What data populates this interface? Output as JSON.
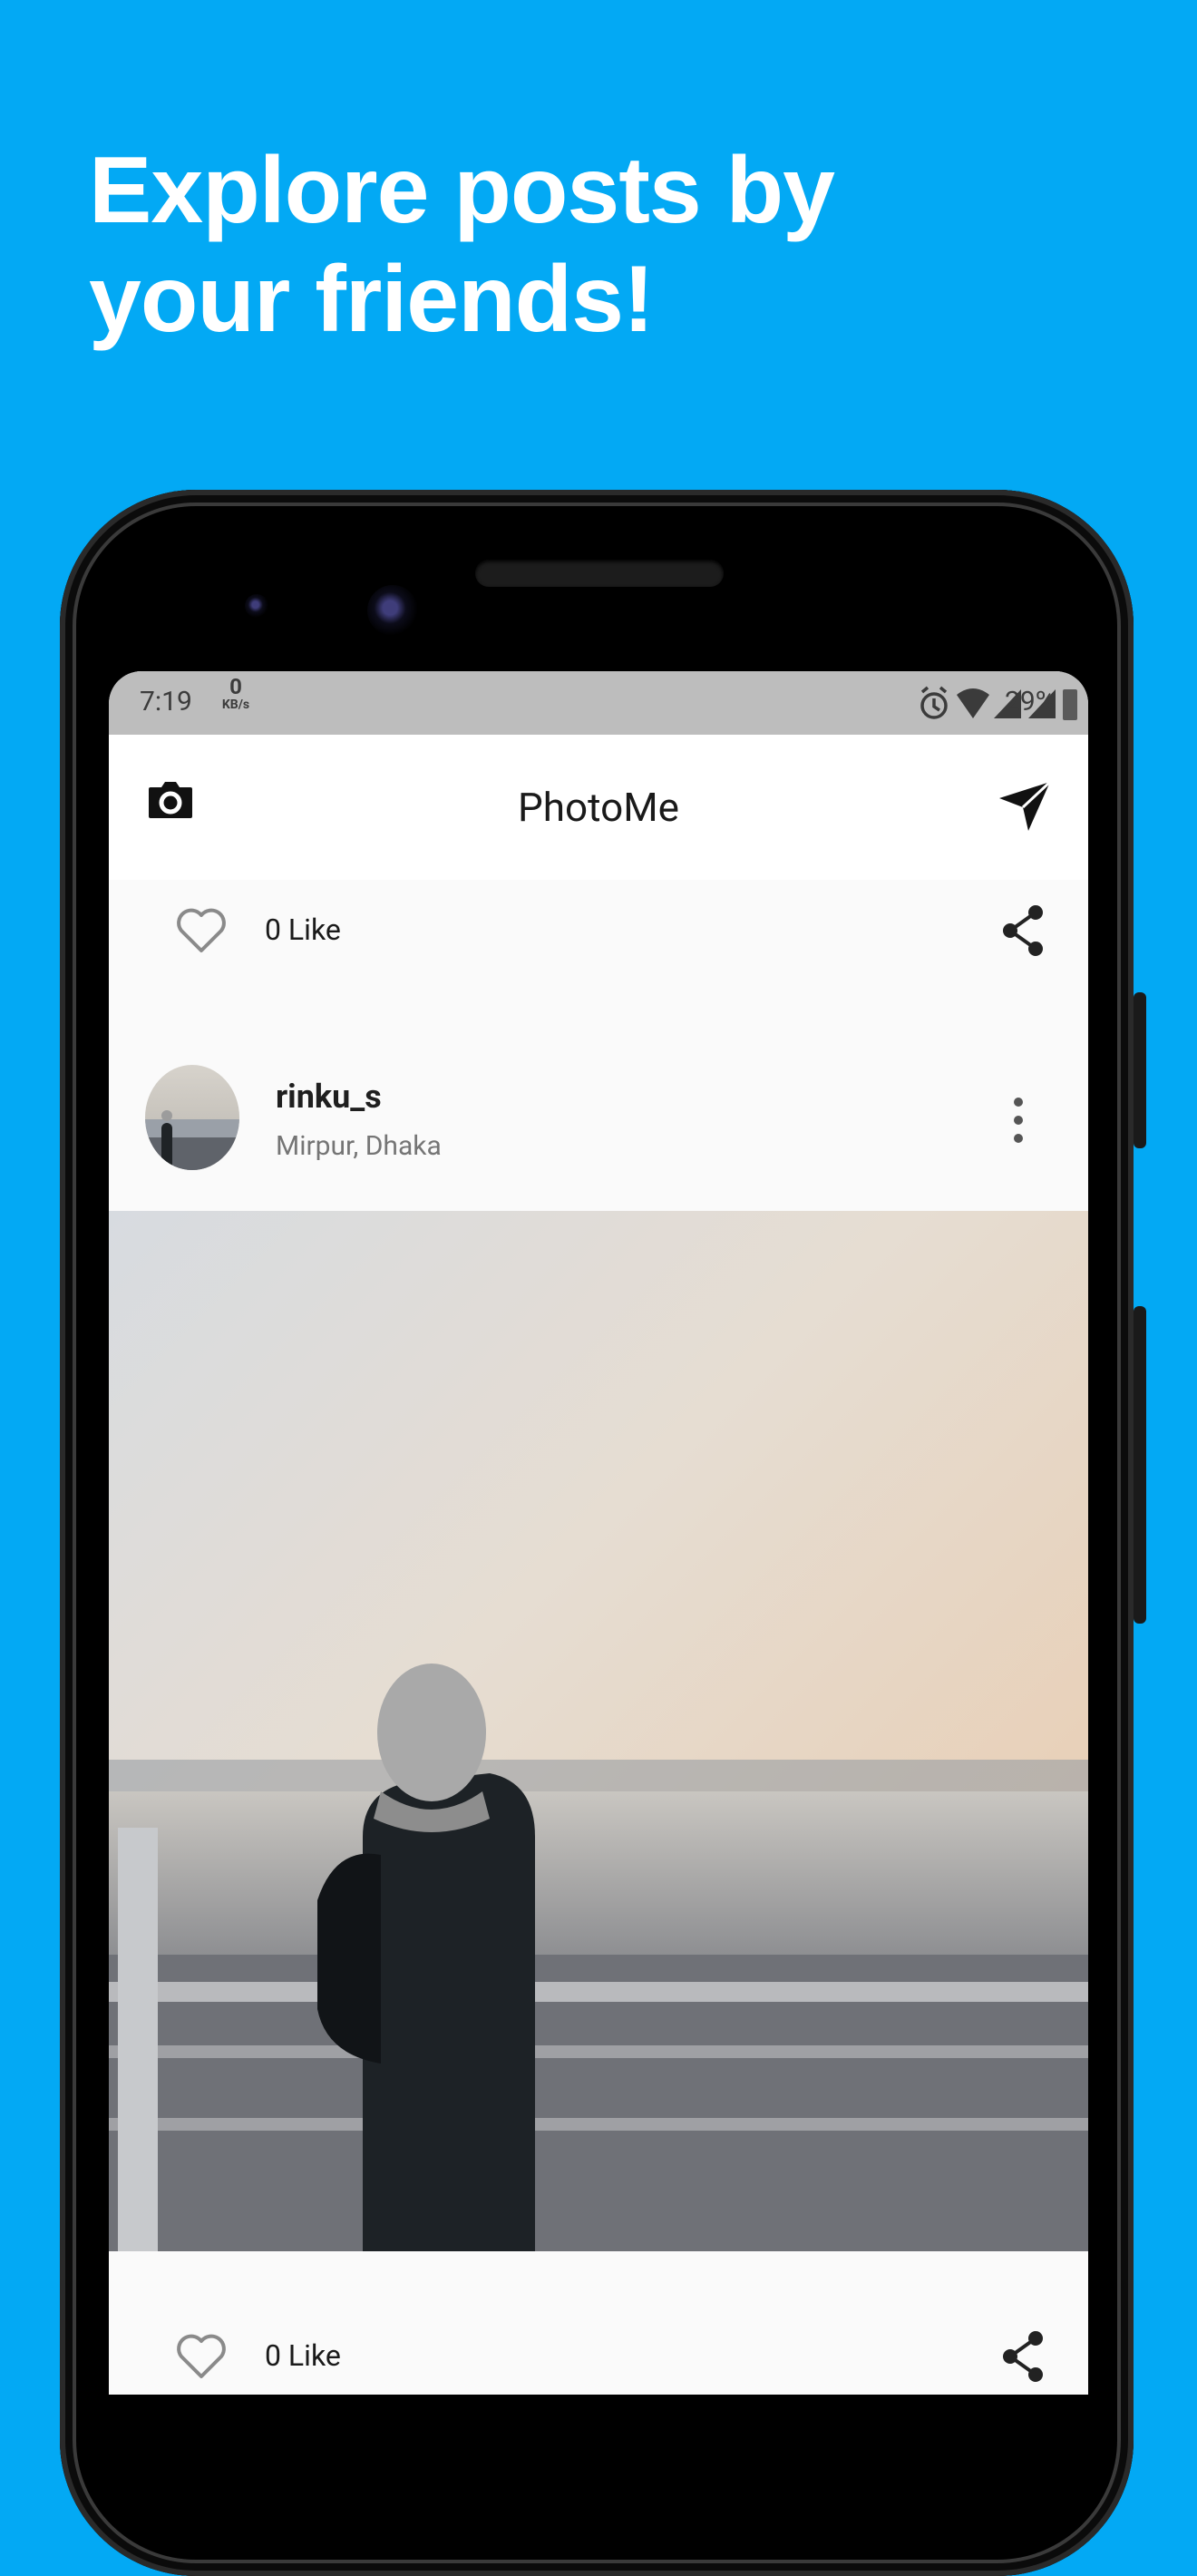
{
  "promo": {
    "headline_line1": "Explore posts by",
    "headline_line2": "your friends!"
  },
  "status_bar": {
    "time": "7:19",
    "net_speed_value": "0",
    "net_speed_unit": "KB/s",
    "battery": "29%"
  },
  "app_bar": {
    "title": "PhotoMe",
    "left_icon": "camera-icon",
    "right_icon": "send-icon"
  },
  "previous_post": {
    "like_text": "0 Like"
  },
  "post": {
    "username": "rinku_s",
    "location": "Mirpur, Dhaka",
    "like_text": "0 Like"
  },
  "colors": {
    "background": "#03A9F4",
    "app_bar": "#FFFFFF",
    "status_bar": "#BDBDBD"
  }
}
